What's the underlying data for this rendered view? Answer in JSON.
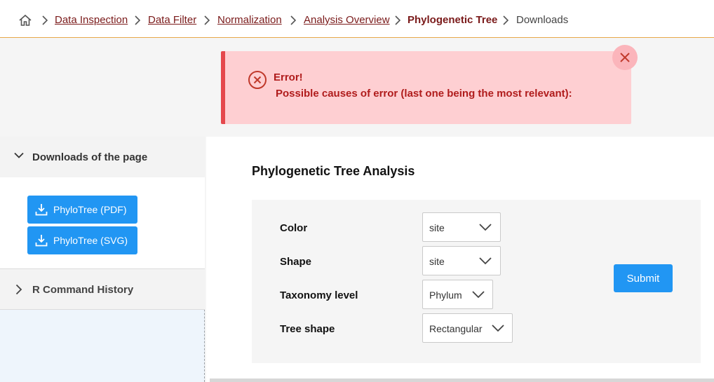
{
  "breadcrumb": {
    "items": [
      {
        "label": "Data Inspection"
      },
      {
        "label": "Data Filter"
      },
      {
        "label": "Normalization"
      },
      {
        "label": "Analysis Overview"
      },
      {
        "label": "Phylogenetic Tree"
      },
      {
        "label": "Downloads"
      }
    ]
  },
  "alert": {
    "title": "Error!",
    "message": "Possible causes of error (last one being the most relevant):"
  },
  "sidebar": {
    "downloads_header": "Downloads of the page",
    "buttons": [
      {
        "label": "PhyloTree (PDF)"
      },
      {
        "label": "PhyloTree (SVG)"
      }
    ],
    "history_header": "R Command History"
  },
  "main": {
    "title": "Phylogenetic Tree Analysis",
    "fields": [
      {
        "label": "Color",
        "value": "site"
      },
      {
        "label": "Shape",
        "value": "site"
      },
      {
        "label": "Taxonomy level",
        "value": "Phylum"
      },
      {
        "label": "Tree shape",
        "value": "Rectangular"
      }
    ],
    "submit_label": "Submit"
  },
  "colors": {
    "accent": "#2196f3",
    "breadcrumb_link": "#7a1a1a",
    "error_text": "#b01c1c",
    "error_bg": "#fecfd2"
  }
}
